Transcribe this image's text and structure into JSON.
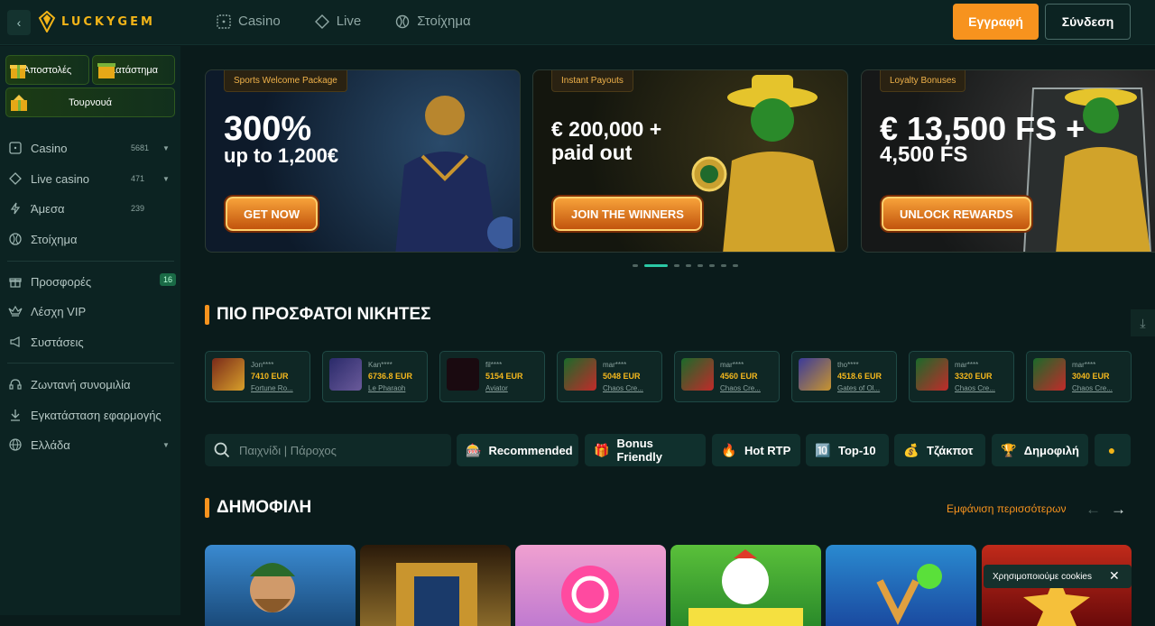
{
  "header": {
    "logo": "LUCKYGEM",
    "nav": [
      {
        "label": "Casino",
        "icon": "dice-icon"
      },
      {
        "label": "Live",
        "icon": "chip-icon"
      },
      {
        "label": "Στοίχημα",
        "icon": "ball-icon"
      }
    ],
    "register_label": "Εγγραφή",
    "login_label": "Σύνδεση"
  },
  "sidebar": {
    "promos": [
      "Αποστολές",
      "Κατάστημα",
      "Τουρνουά"
    ],
    "items": [
      {
        "label": "Casino",
        "count": "5681"
      },
      {
        "label": "Live casino",
        "count": "471"
      },
      {
        "label": "Άμεσα",
        "count": "239"
      },
      {
        "label": "Στοίχημα"
      },
      {
        "label": "Προσφορές",
        "badge": "16"
      },
      {
        "label": "Λέσχη VIP"
      },
      {
        "label": "Συστάσεις"
      },
      {
        "label": "Ζωντανή συνομιλία"
      },
      {
        "label": "Εγκατάσταση εφαρμογής"
      },
      {
        "label": "Ελλάδα"
      }
    ]
  },
  "banners": [
    {
      "tag": "Sports Welcome Package",
      "line1": "300%",
      "line2": "up to 1,200€",
      "cta": "GET NOW"
    },
    {
      "tag": "Instant Payouts",
      "line1": "€ 200,000 +",
      "line2": "paid out",
      "cta": "JOIN THE WINNERS"
    },
    {
      "tag": "Loyalty Bonuses",
      "line1": "€ 13,500 FS +",
      "line2": "4,500 FS",
      "cta": "UNLOCK REWARDS"
    }
  ],
  "carousel": {
    "dots": 8,
    "active": 1
  },
  "winners_title": "ΠΙΟ ΠΡΟΣΦΑΤΟΙ ΝΙΚΗΤΕΣ",
  "winners": [
    {
      "user": "Jon****",
      "amount": "7410 EUR",
      "game": "Fortune Ro..."
    },
    {
      "user": "Kan****",
      "amount": "6736.8 EUR",
      "game": "Le Pharaoh"
    },
    {
      "user": "fil****",
      "amount": "5154 EUR",
      "game": "Aviator"
    },
    {
      "user": "mar****",
      "amount": "5048 EUR",
      "game": "Chaos Cre..."
    },
    {
      "user": "mar****",
      "amount": "4560 EUR",
      "game": "Chaos Cre..."
    },
    {
      "user": "tho****",
      "amount": "4518.6 EUR",
      "game": "Gates of Ol..."
    },
    {
      "user": "mar****",
      "amount": "3320 EUR",
      "game": "Chaos Cre..."
    },
    {
      "user": "mar****",
      "amount": "3040 EUR",
      "game": "Chaos Cre..."
    }
  ],
  "search": {
    "placeholder": "Παιχνίδι | Πάροχος"
  },
  "filters": [
    {
      "label": "Recommended",
      "icon": "🎰"
    },
    {
      "label": "Bonus Friendly",
      "icon": "🎁"
    },
    {
      "label": "Hot RTP",
      "icon": "🔥"
    },
    {
      "label": "Top-10",
      "icon": "🔟"
    },
    {
      "label": "Τζάκποτ",
      "icon": "💰"
    },
    {
      "label": "Δημοφιλή",
      "icon": "🏆"
    }
  ],
  "popular": {
    "title": "ΔΗΜΟΦΙΛΗ",
    "show_more": "Εμφάνιση περισσότερων"
  },
  "cookie": {
    "text": "Χρησιμοποιούμε cookies"
  }
}
